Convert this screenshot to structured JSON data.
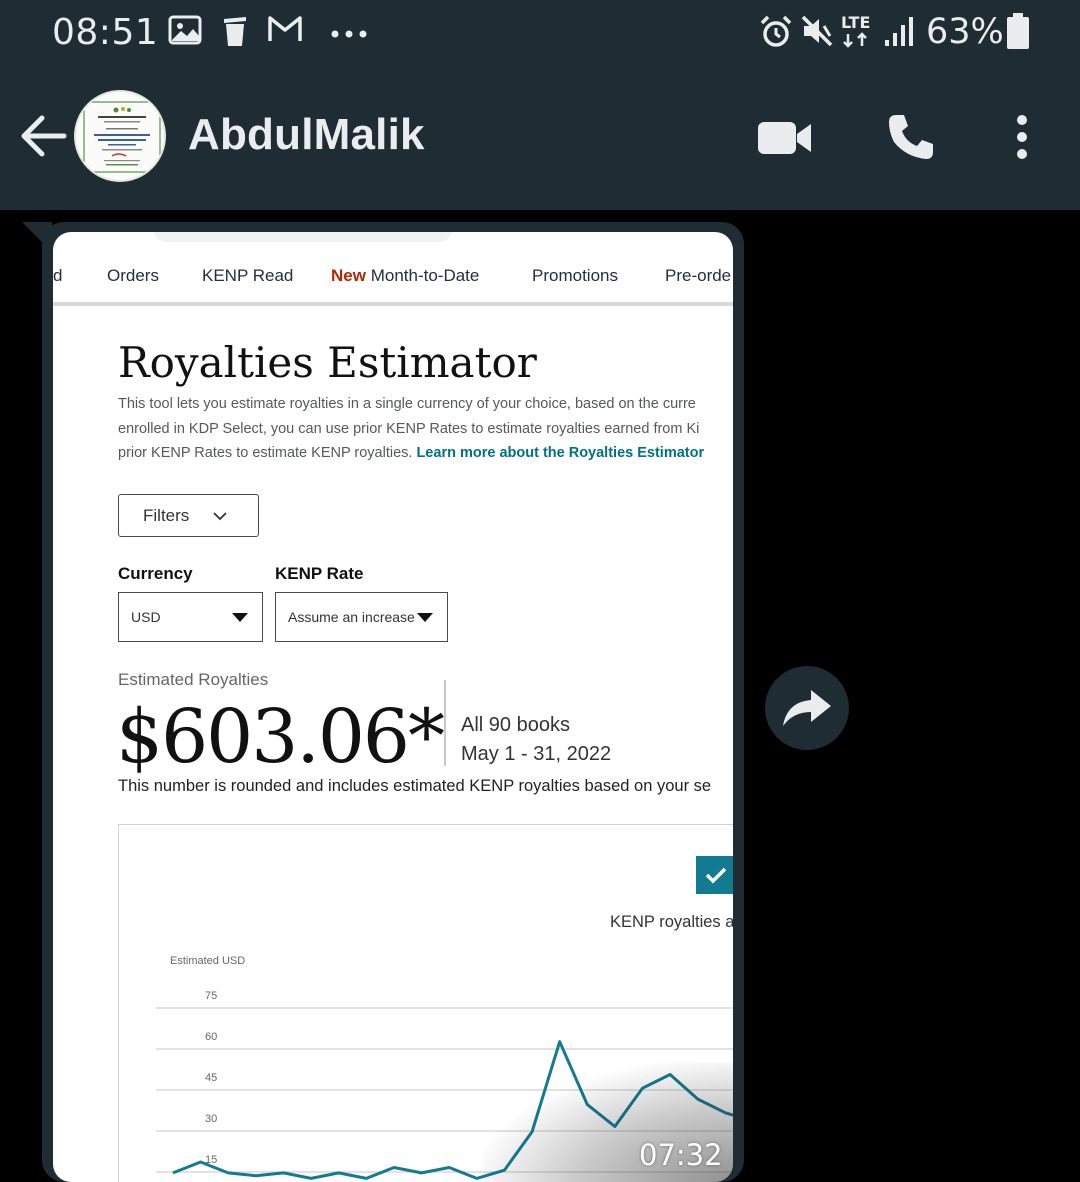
{
  "status_bar": {
    "time": "08:51",
    "network": "LTE",
    "battery": "63%",
    "icons": [
      "image-icon",
      "trash-icon",
      "gmail-icon",
      "more-dots-icon",
      "alarm-icon",
      "mute-icon",
      "lte-icon",
      "signal-icon",
      "battery-icon"
    ]
  },
  "header": {
    "contact_name": "AbdulMalik",
    "icons": [
      "back-arrow-icon",
      "video-call-icon",
      "phone-icon",
      "more-vert-icon"
    ]
  },
  "message": {
    "video_duration": "07:32",
    "screenshot": {
      "tabs": [
        {
          "label": "d"
        },
        {
          "label": "Orders"
        },
        {
          "label": "KENP Read"
        },
        {
          "badge": "New",
          "label": "Month-to-Date"
        },
        {
          "label": "Promotions"
        },
        {
          "label": "Pre-orde"
        }
      ],
      "title": "Royalties Estimator",
      "intro_line1": "This tool lets you estimate royalties in a single currency of your choice, based on the curre",
      "intro_line2": "enrolled in KDP Select, you can use prior KENP Rates to estimate royalties earned from Ki",
      "intro_line3": "prior KENP Rates to estimate KENP royalties.",
      "intro_link": "Learn more about the Royalties Estimator",
      "filters_label": "Filters",
      "currency_label": "Currency",
      "currency_value": "USD",
      "kenp_rate_label": "KENP Rate",
      "kenp_rate_value": "Assume an increase",
      "estimated_label": "Estimated Royalties",
      "estimated_amount": "$603.06*",
      "books": "All 90 books",
      "date_range": "May 1 - 31, 2022",
      "rounded_note": "This number is rounded and includes estimated KENP royalties based on your se",
      "legend_text": "KENP royalties a",
      "accent_color": "#127b91"
    }
  },
  "chart_data": {
    "type": "line",
    "ylabel": "Estimated USD",
    "y_ticks": [
      15,
      30,
      45,
      60,
      75
    ],
    "ylim": [
      0,
      75
    ],
    "series": [
      {
        "x": [
          1,
          2,
          3,
          4,
          5,
          6,
          7,
          8,
          9,
          10,
          11,
          12,
          13,
          14,
          15,
          16,
          17,
          18,
          19,
          20,
          21,
          22
        ],
        "values": [
          11,
          15,
          11,
          10,
          11,
          9,
          11,
          9,
          13,
          11,
          13,
          9,
          12,
          26,
          59,
          36,
          28,
          42,
          47,
          38,
          33,
          30
        ]
      }
    ],
    "color": "#127b91"
  }
}
